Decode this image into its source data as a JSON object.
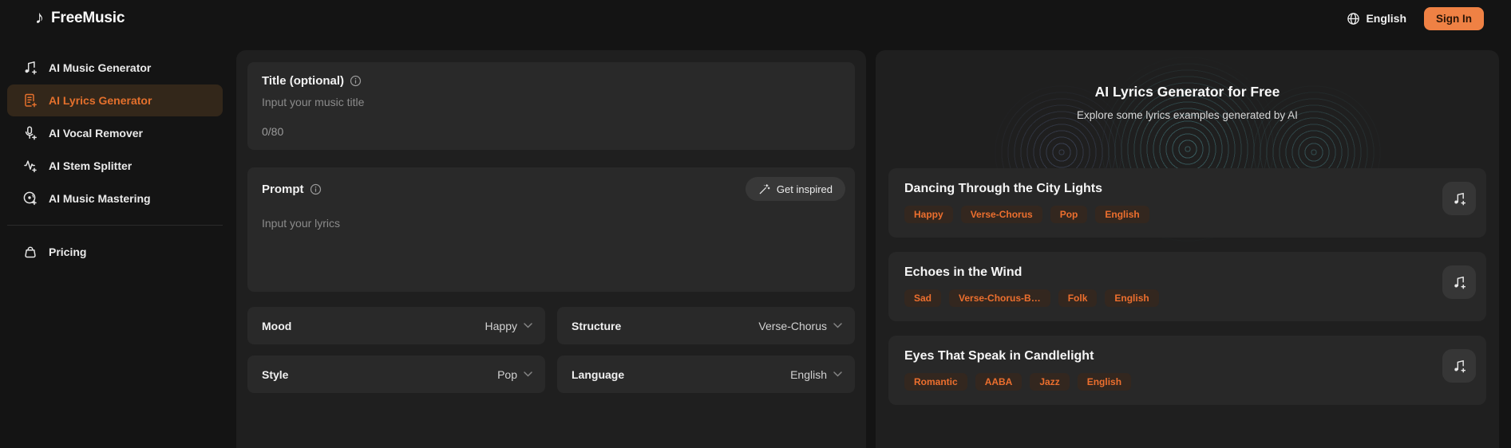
{
  "header": {
    "brand": "FreeMusic",
    "brand_icon": "music-note-icon",
    "language": "English",
    "language_icon": "globe-icon",
    "sign_in_label": "Sign In"
  },
  "sidebar": {
    "items": [
      {
        "label": "AI Music Generator",
        "icon": "music-note-plus-icon",
        "active": false
      },
      {
        "label": "AI Lyrics Generator",
        "icon": "lyrics-plus-icon",
        "active": true
      },
      {
        "label": "AI Vocal Remover",
        "icon": "microphone-plus-icon",
        "active": false
      },
      {
        "label": "AI Stem Splitter",
        "icon": "waveform-plus-icon",
        "active": false
      },
      {
        "label": "AI Music Mastering",
        "icon": "disc-plus-icon",
        "active": false
      }
    ],
    "secondary_items": [
      {
        "label": "Pricing",
        "icon": "wallet-icon"
      }
    ]
  },
  "form": {
    "title_field": {
      "label": "Title (optional)",
      "placeholder": "Input your music title",
      "counter": "0/80"
    },
    "prompt_field": {
      "label": "Prompt",
      "placeholder": "Input your lyrics",
      "inspire_button": "Get inspired",
      "inspire_icon": "magic-wand-icon"
    },
    "selects": [
      {
        "label": "Mood",
        "value": "Happy"
      },
      {
        "label": "Structure",
        "value": "Verse-Chorus"
      },
      {
        "label": "Style",
        "value": "Pop"
      },
      {
        "label": "Language",
        "value": "English"
      }
    ]
  },
  "examples": {
    "title": "AI Lyrics Generator for Free",
    "subtitle": "Explore some lyrics examples generated by AI",
    "cards": [
      {
        "title": "Dancing Through the City Lights",
        "tags": [
          "Happy",
          "Verse-Chorus",
          "Pop",
          "English"
        ],
        "action_icon": "music-note-plus-icon"
      },
      {
        "title": "Echoes in the Wind",
        "tags": [
          "Sad",
          "Verse-Chorus-B…",
          "Folk",
          "English"
        ],
        "action_icon": "music-note-plus-icon"
      },
      {
        "title": "Eyes That Speak in Candlelight",
        "tags": [
          "Romantic",
          "AABA",
          "Jazz",
          "English"
        ],
        "action_icon": "music-note-plus-icon"
      }
    ]
  },
  "colors": {
    "accent_orange": "#ED6F2E",
    "sign_in_bg": "#EF8144",
    "active_item_bg": "#33271A",
    "page_bg": "#141414",
    "panel_bg": "#1F1F1F",
    "card_bg": "#292929",
    "tag_bg": "#33271F",
    "ripple_teal": "#69CFD8",
    "ripple_blue": "#86A0E4"
  }
}
